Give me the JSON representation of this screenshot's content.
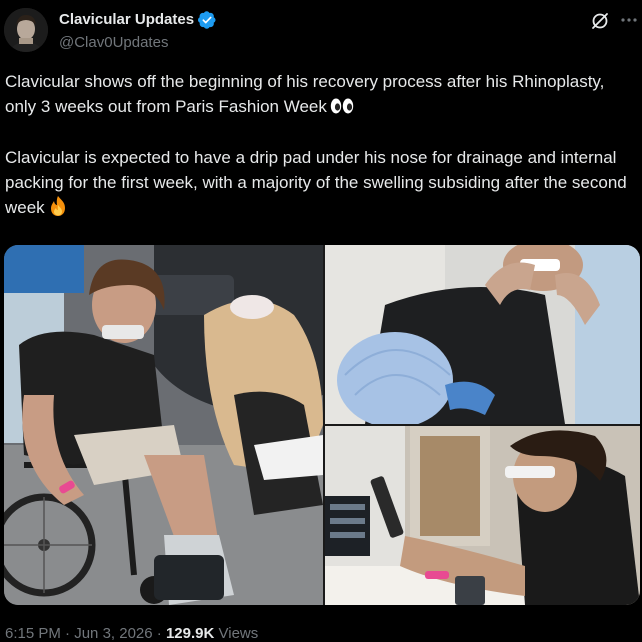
{
  "author": {
    "name": "Clavicular Updates",
    "handle": "@Clav0Updates",
    "verified": true,
    "verified_color": "#1d9bf0"
  },
  "header_icons": [
    "grok-icon",
    "more-icon"
  ],
  "text": {
    "paragraph_1": "Clavicular shows off the beginning of his recovery process after his Rhinoplasty, only 3 weeks out from Paris Fashion Week",
    "paragraph_2": "Clavicular is expected to have a drip pad under his nose for drainage and internal packing for the first week, with a majority of the swelling subsiding after the second week"
  },
  "emojis": [
    "eyes-emoji",
    "fire-emoji"
  ],
  "media": {
    "photo_count": 3
  },
  "meta": {
    "time": "6:15 PM",
    "separator": "·",
    "date": "Jun 3, 2026",
    "views_count": "129.9K",
    "views_label": "Views"
  },
  "colors": {
    "background": "#000000",
    "primary_text": "#e7e9ea",
    "secondary_text": "#71767b"
  }
}
